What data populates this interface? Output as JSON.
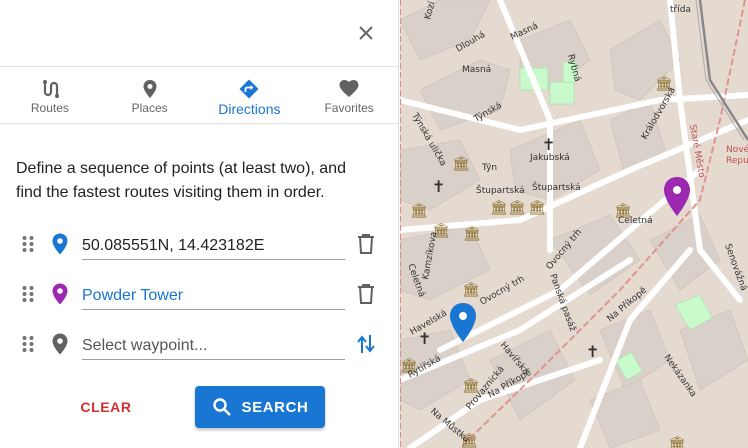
{
  "panel": {
    "tabs": [
      {
        "label": "Routes",
        "icon": "routes-icon"
      },
      {
        "label": "Places",
        "icon": "place-icon"
      },
      {
        "label": "Directions",
        "icon": "directions-icon"
      },
      {
        "label": "Favorites",
        "icon": "heart-icon"
      }
    ],
    "active_tab": "Directions",
    "description": "Define a sequence of points (at least two), and find the fastest routes visiting them in order.",
    "waypoints": [
      {
        "value": "50.085551N, 14.423182E",
        "pin_color": "#1976d2",
        "action": "delete-icon"
      },
      {
        "value": "Powder Tower",
        "pin_color": "#9c27b0",
        "action": "delete-icon"
      },
      {
        "value": "",
        "placeholder": "Select waypoint...",
        "pin_color": "#616161",
        "action": "swap-icon"
      }
    ],
    "clear_label": "CLEAR",
    "search_label": "SEARCH"
  },
  "map": {
    "streets": [
      "Dlouhá",
      "Masná",
      "Rybná",
      "Týnská",
      "Týn",
      "Jakubská",
      "Štupartská",
      "Celetná",
      "Králodvorská",
      "Ovocný trh",
      "Na Příkopě",
      "Havelská",
      "Rytířská",
      "Provaznická",
      "Na Můstku",
      "Panská pasáž",
      "Nekázanka",
      "Senovážná",
      "Kamzíkova",
      "Celetná",
      "Kozí",
      "Staré Město",
      "Nové Město",
      "třída",
      "Repu",
      "Týnská ulička",
      "Masná",
      "Dlouhá"
    ],
    "colors": {
      "base": "#e4dad0",
      "building": "#d9d0c9",
      "road": "#ffffff",
      "park": "#c8facc",
      "district": "#e08b8b"
    }
  }
}
